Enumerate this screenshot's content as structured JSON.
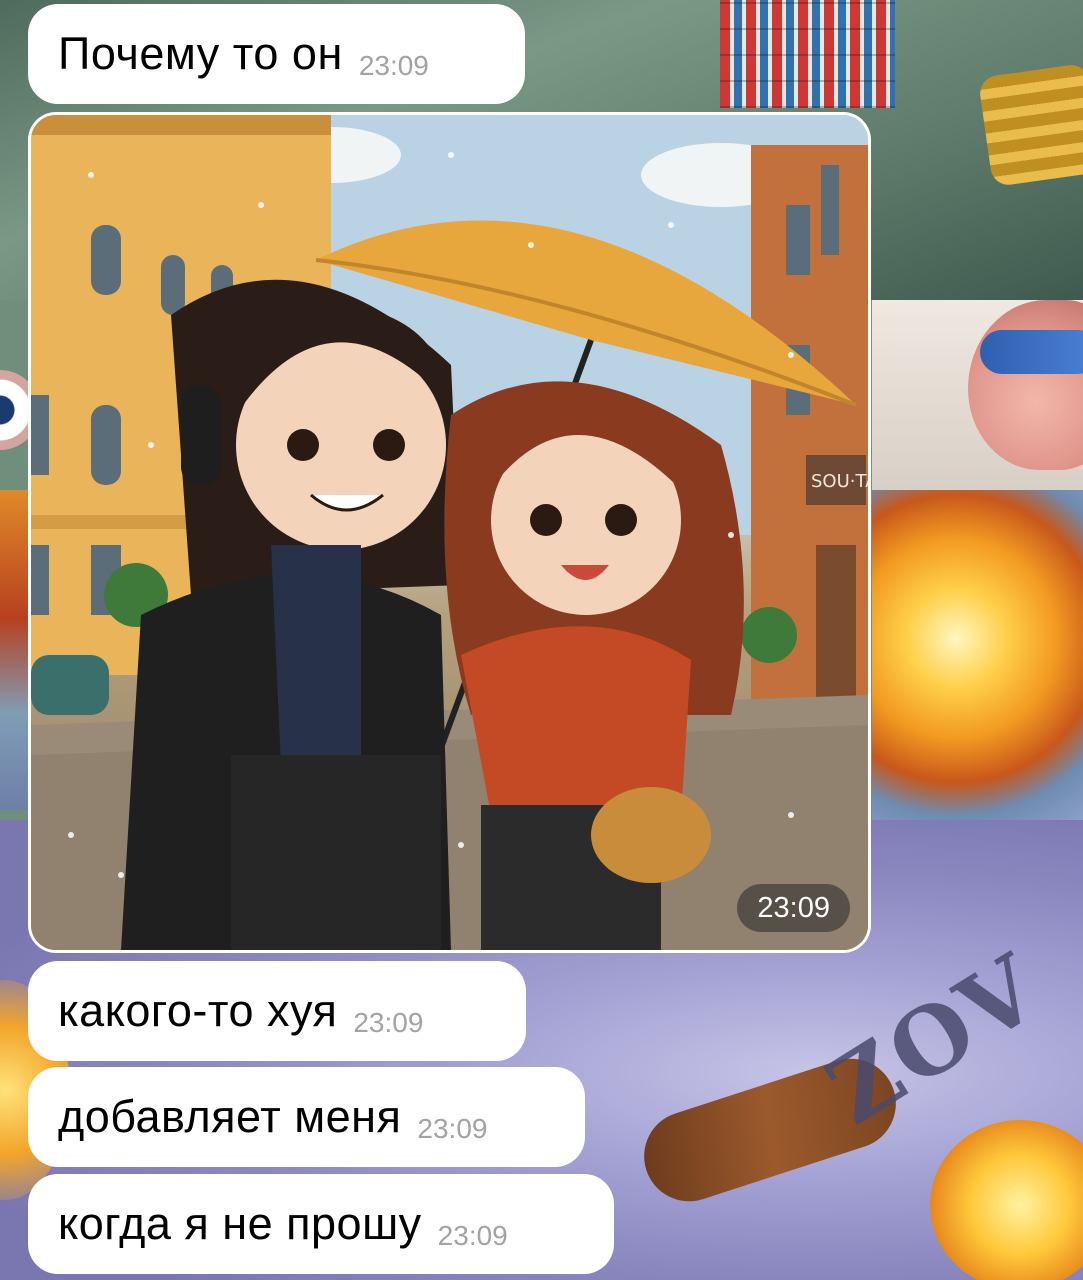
{
  "messages": [
    {
      "type": "text",
      "text": "Почему то он",
      "time": "23:09"
    },
    {
      "type": "photo",
      "caption_time": "23:09",
      "sign_text": "SOU·TA"
    },
    {
      "type": "text",
      "text": "какого-то хуя",
      "time": "23:09"
    },
    {
      "type": "text",
      "text": "добавляет меня",
      "time": "23:09"
    },
    {
      "type": "text",
      "text": "когда я не прошу",
      "time": "23:09"
    }
  ],
  "wallpaper": {
    "graffiti_text": "ZOV"
  },
  "colors": {
    "bubble_bg": "#ffffff",
    "time_text": "#a3a3a3",
    "umbrella": "#e7a73d",
    "building": "#e9b45a"
  }
}
